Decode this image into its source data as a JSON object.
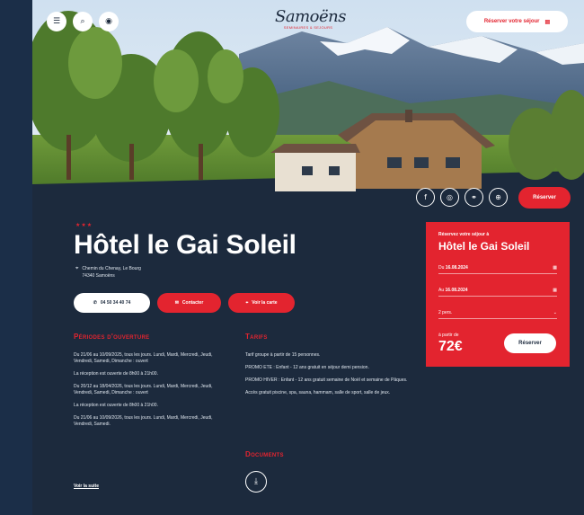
{
  "header": {
    "icons": [
      "menu-icon",
      "search-icon",
      "eye-icon"
    ],
    "logo_text": "Samoëns",
    "logo_tagline": "SEMINAIRES & SEJOURS",
    "book_button": "Réserver votre séjour"
  },
  "hero": {
    "social_icons": [
      "facebook-icon",
      "instagram-icon",
      "link-icon",
      "globe-icon"
    ],
    "reserve_button": "Réserver"
  },
  "hotel": {
    "stars": "★★★",
    "name": "Hôtel le Gai Soleil",
    "address_line1": "Chemin du Chenay, Le Bourg",
    "address_line2": "74340 Samoëns"
  },
  "actions": {
    "phone": "04 50 34 40 74",
    "contact": "Contacter",
    "map": "Voir la carte"
  },
  "opening": {
    "title": "Périodes d'ouverture",
    "paragraphs": [
      "Du 21/06 au 10/09/2025, tous les jours. Lundi, Mardi, Mercredi, Jeudi, Vendredi, Samedi, Dimanche : ouvert",
      "La réception est ouverte de 8h00 à 21h00.",
      "Du 20/12 au 18/04/2026, tous les jours. Lundi, Mardi, Mercredi, Jeudi, Vendredi, Samedi, Dimanche : ouvert",
      "La réception est ouverte de 8h00 à 21h00.",
      "Du 21/06 au 10/09/2026, tous les jours. Lundi, Mardi, Mercredi, Jeudi, Vendredi, Samedi."
    ],
    "see_more": "Voir la suite"
  },
  "tarifs": {
    "title": "Tarifs",
    "paragraphs": [
      "Tarif groupe à partir de 15 personnes.",
      "PROMO ETE : Enfant - 12 ans gratuit en séjour demi pension.",
      "PROMO HIVER : Enfant - 12 ans gratuit semaine de Noël et semaine de Pâques.",
      "Accès gratuit piscine, spa, sauna, hammam, salle de sport, salle de jeux."
    ]
  },
  "documents": {
    "title": "Documents",
    "icon": "download-icon"
  },
  "booking": {
    "kicker": "Réservez votre séjour à",
    "hotel": "Hôtel le Gai Soleil",
    "from_label": "Du",
    "from_date": "16.08.2024",
    "to_label": "Au",
    "to_date": "16.08.2024",
    "guests": "2 pers.",
    "price_label": "à partir de",
    "price": "72€",
    "button": "Réserver"
  }
}
